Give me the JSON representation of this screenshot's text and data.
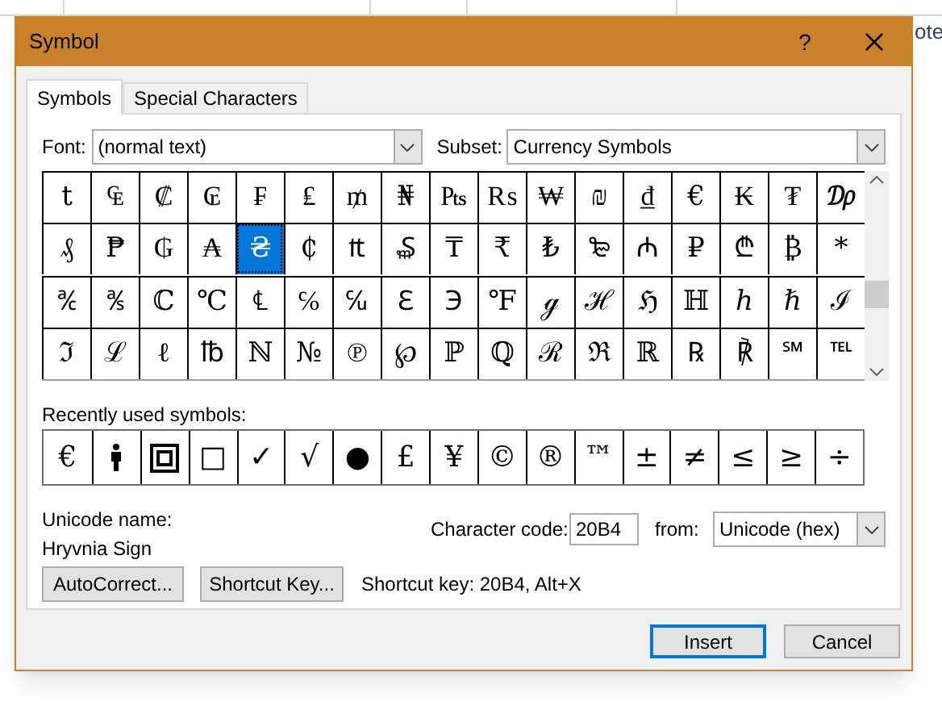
{
  "background": {
    "doc_text": "ote"
  },
  "window": {
    "title": "Symbol",
    "help": "?"
  },
  "tabs": [
    {
      "label": "Symbols",
      "selected": true
    },
    {
      "label": "Special Characters",
      "selected": false
    }
  ],
  "font": {
    "label": "Font:",
    "value": "(normal text)"
  },
  "subset": {
    "label": "Subset:",
    "value": "Currency Symbols"
  },
  "symbol_grid": [
    [
      {
        "glyph": "t",
        "selected": false
      },
      {
        "glyph": "₠",
        "selected": false
      },
      {
        "glyph": "₡",
        "selected": false
      },
      {
        "glyph": "₢",
        "selected": false
      },
      {
        "glyph": "₣",
        "selected": false
      },
      {
        "glyph": "₤",
        "selected": false
      },
      {
        "glyph": "₥",
        "selected": false
      },
      {
        "glyph": "₦",
        "selected": false
      },
      {
        "glyph": "₧",
        "selected": false
      },
      {
        "glyph": "₨",
        "selected": false
      },
      {
        "glyph": "₩",
        "selected": false
      },
      {
        "glyph": "₪",
        "selected": false
      },
      {
        "glyph": "₫",
        "selected": false
      },
      {
        "glyph": "€",
        "selected": false
      },
      {
        "glyph": "₭",
        "selected": false
      },
      {
        "glyph": "₮",
        "selected": false
      },
      {
        "glyph": "₯",
        "selected": false
      }
    ],
    [
      {
        "glyph": "₰",
        "selected": false
      },
      {
        "glyph": "₱",
        "selected": false
      },
      {
        "glyph": "₲",
        "selected": false
      },
      {
        "glyph": "₳",
        "selected": false
      },
      {
        "glyph": "₴",
        "selected": true
      },
      {
        "glyph": "₵",
        "selected": false
      },
      {
        "glyph": "₶",
        "selected": false
      },
      {
        "glyph": "₷",
        "selected": false
      },
      {
        "glyph": "₸",
        "selected": false
      },
      {
        "glyph": "₹",
        "selected": false
      },
      {
        "glyph": "₺",
        "selected": false
      },
      {
        "glyph": "₻",
        "selected": false
      },
      {
        "glyph": "₼",
        "selected": false
      },
      {
        "glyph": "₽",
        "selected": false
      },
      {
        "glyph": "₾",
        "selected": false
      },
      {
        "glyph": "₿",
        "selected": false
      },
      {
        "glyph": "*",
        "selected": false
      }
    ],
    [
      {
        "glyph": "℀",
        "selected": false
      },
      {
        "glyph": "℁",
        "selected": false
      },
      {
        "glyph": "ℂ",
        "selected": false
      },
      {
        "glyph": "℃",
        "selected": false
      },
      {
        "glyph": "℄",
        "selected": false
      },
      {
        "glyph": "℅",
        "selected": false
      },
      {
        "glyph": "℆",
        "selected": false
      },
      {
        "glyph": "ℇ",
        "selected": false
      },
      {
        "glyph": "℈",
        "selected": false
      },
      {
        "glyph": "℉",
        "selected": false
      },
      {
        "glyph": "ℊ",
        "selected": false
      },
      {
        "glyph": "ℋ",
        "selected": false
      },
      {
        "glyph": "ℌ",
        "selected": false
      },
      {
        "glyph": "ℍ",
        "selected": false
      },
      {
        "glyph": "ℎ",
        "selected": false
      },
      {
        "glyph": "ℏ",
        "selected": false
      },
      {
        "glyph": "ℐ",
        "selected": false
      }
    ],
    [
      {
        "glyph": "ℑ",
        "selected": false
      },
      {
        "glyph": "ℒ",
        "selected": false
      },
      {
        "glyph": "ℓ",
        "selected": false
      },
      {
        "glyph": "℔",
        "selected": false
      },
      {
        "glyph": "ℕ",
        "selected": false
      },
      {
        "glyph": "№",
        "selected": false
      },
      {
        "glyph": "℗",
        "selected": false
      },
      {
        "glyph": "℘",
        "selected": false
      },
      {
        "glyph": "ℙ",
        "selected": false
      },
      {
        "glyph": "ℚ",
        "selected": false
      },
      {
        "glyph": "ℛ",
        "selected": false
      },
      {
        "glyph": "ℜ",
        "selected": false
      },
      {
        "glyph": "ℝ",
        "selected": false
      },
      {
        "glyph": "℞",
        "selected": false
      },
      {
        "glyph": "℟",
        "selected": false
      },
      {
        "glyph": "℠",
        "selected": false
      },
      {
        "glyph": "℡",
        "selected": false
      }
    ]
  ],
  "recent_label": "Recently used symbols:",
  "recent_symbols": [
    {
      "kind": "text",
      "glyph": "€"
    },
    {
      "kind": "figure"
    },
    {
      "kind": "framed-square"
    },
    {
      "kind": "text",
      "glyph": "□"
    },
    {
      "kind": "text",
      "glyph": "✓"
    },
    {
      "kind": "text",
      "glyph": "√"
    },
    {
      "kind": "text",
      "glyph": "●"
    },
    {
      "kind": "text",
      "glyph": "£"
    },
    {
      "kind": "text",
      "glyph": "¥"
    },
    {
      "kind": "text",
      "glyph": "©"
    },
    {
      "kind": "text",
      "glyph": "®"
    },
    {
      "kind": "text",
      "glyph": "™"
    },
    {
      "kind": "text",
      "glyph": "±"
    },
    {
      "kind": "text",
      "glyph": "≠"
    },
    {
      "kind": "text",
      "glyph": "≤"
    },
    {
      "kind": "text",
      "glyph": "≥"
    },
    {
      "kind": "text",
      "glyph": "÷"
    }
  ],
  "unicode_name": {
    "label": "Unicode name:",
    "value": "Hryvnia Sign"
  },
  "character_code": {
    "label": "Character code:",
    "value": "20B4"
  },
  "from": {
    "label": "from:",
    "value": "Unicode (hex)"
  },
  "buttons": [
    {
      "label": "AutoCorrect..."
    },
    {
      "label": "Shortcut Key..."
    }
  ],
  "shortcut_text": "Shortcut key: 20B4, Alt+X",
  "footer_buttons": [
    {
      "label": "Insert",
      "default": true
    },
    {
      "label": "Cancel",
      "default": false
    }
  ]
}
